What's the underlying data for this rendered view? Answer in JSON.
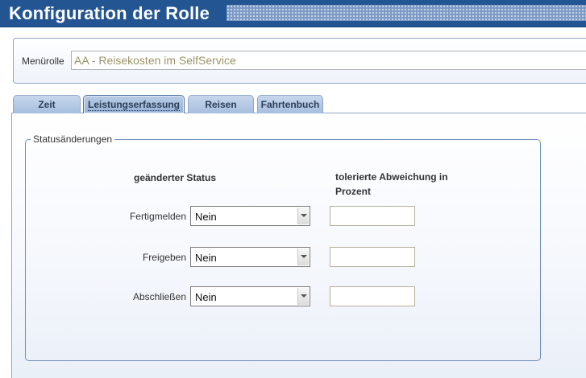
{
  "window": {
    "title": "Konfiguration der Rolle"
  },
  "role": {
    "label": "Menürolle",
    "value": "AA - Reisekosten im SelfService"
  },
  "tabs": [
    {
      "label": "Zeit",
      "active": false
    },
    {
      "label": "Leistungserfassung",
      "active": true
    },
    {
      "label": "Reisen",
      "active": false
    },
    {
      "label": "Fahrtenbuch",
      "active": false
    }
  ],
  "status_section": {
    "legend": "Statusänderungen",
    "col_status": "geänderter Status",
    "col_deviation": "tolerierte Abweichung in Prozent",
    "rows": [
      {
        "label": "Fertigmelden",
        "status": "Nein",
        "deviation": ""
      },
      {
        "label": "Freigeben",
        "status": "Nein",
        "deviation": ""
      },
      {
        "label": "Abschließen",
        "status": "Nein",
        "deviation": ""
      }
    ]
  },
  "colors": {
    "title_bar": "#245593",
    "tab_bg": "#a6bedf",
    "panel_border": "#8fa8c8",
    "fieldset_border": "#6f8fb8"
  },
  "icons": {
    "select_arrow": "chevron-down-icon"
  }
}
